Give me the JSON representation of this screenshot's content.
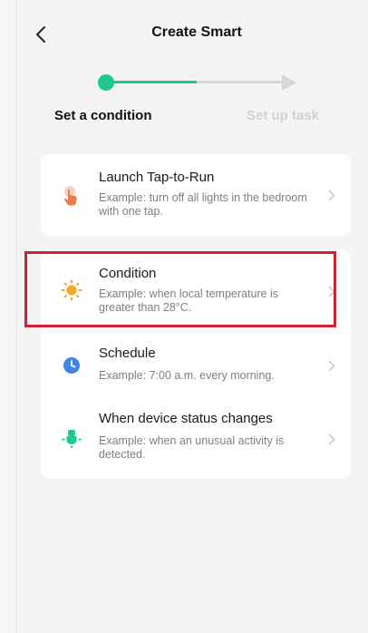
{
  "header": {
    "title": "Create Smart",
    "back_icon": "chevron-left-icon"
  },
  "stepper": {
    "steps": [
      {
        "label": "Set a condition",
        "state": "active"
      },
      {
        "label": "Set up task",
        "state": "inactive"
      }
    ],
    "active_color": "#1ec991",
    "inactive_color": "#d6d6d6"
  },
  "options": {
    "tap_to_run": {
      "title": "Launch Tap-to-Run",
      "description": "Example: turn off all lights in the bedroom with one tap.",
      "icon": "tap-hand-icon",
      "icon_color": "#f07a4a"
    },
    "items": [
      {
        "title": "Condition",
        "description": "Example: when local temperature is greater than 28°C.",
        "icon": "sun-icon",
        "icon_color": "#f5a623",
        "highlighted": true
      },
      {
        "title": "Schedule",
        "description": "Example: 7:00 a.m. every morning.",
        "icon": "clock-icon",
        "icon_color": "#3f86e6"
      },
      {
        "title": "When device status changes",
        "description": "Example: when an unusual activity is detected.",
        "icon": "device-bulb-icon",
        "icon_color": "#1ec991"
      }
    ]
  },
  "highlight_color": "#d3212e"
}
